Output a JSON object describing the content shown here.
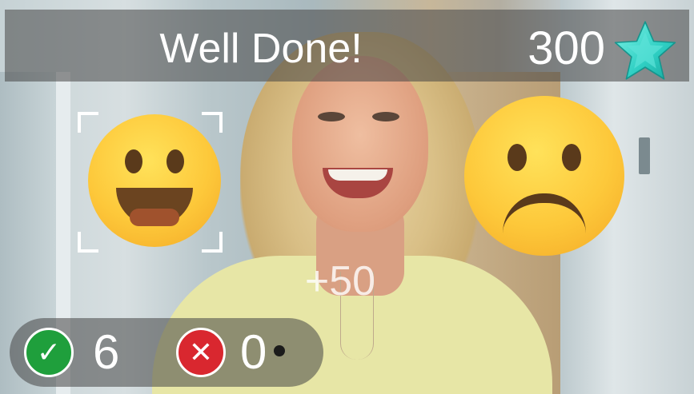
{
  "header": {
    "title": "Well Done!",
    "score": "300",
    "score_icon": "star-icon",
    "star_color": "#35d3c8"
  },
  "choices": {
    "happy_icon": "happy-face-emoji",
    "sad_icon": "sad-face-emoji",
    "selected": "happy"
  },
  "bonus": "+50",
  "tally": {
    "correct_count": "6",
    "correct_icon": "checkmark-icon",
    "correct_color": "#1f9f3c",
    "wrong_count": "0",
    "wrong_icon": "cross-icon",
    "wrong_color": "#d9272f"
  }
}
